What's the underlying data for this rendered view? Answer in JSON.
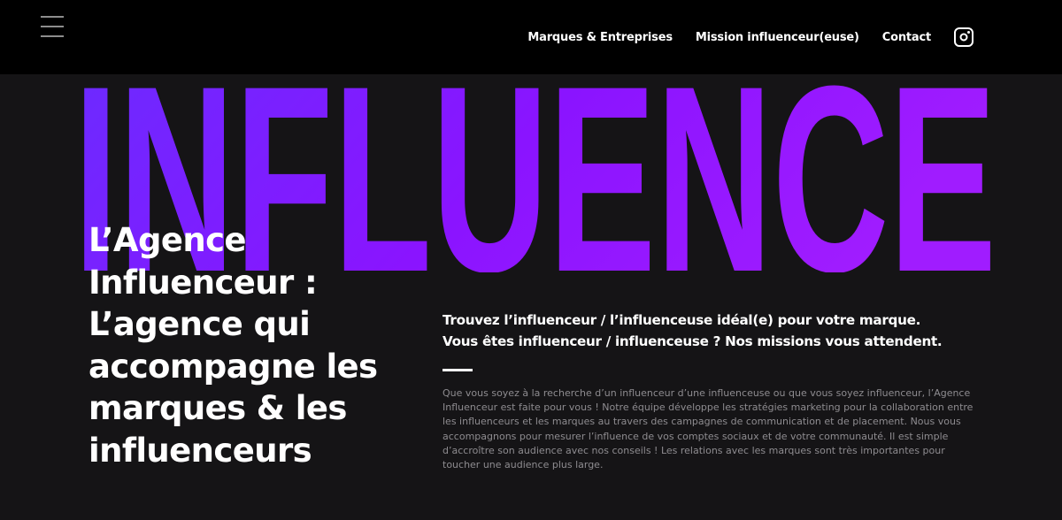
{
  "header": {
    "nav": [
      {
        "label": "Marques & Entreprises"
      },
      {
        "label": "Mission influenceur(euse)"
      },
      {
        "label": "Contact"
      }
    ]
  },
  "hero": {
    "big_word": "INFLUENCE",
    "big_word_colors": [
      "#6a2cff",
      "#8a14ff",
      "#a01cff"
    ],
    "title": "L’Agence Influenceur : L’agence qui accompagne les marques & les influenceurs",
    "tagline_line1": "Trouvez l’influenceur / l’influenceuse idéal(e) pour votre marque.",
    "tagline_line2": "Vous êtes influenceur / influenceuse ? Nos missions vous attendent.",
    "description": "Que vous soyez à la recherche d’un influenceur d’une influenceuse ou que vous soyez influenceur, l’Agence Influenceur est faite pour vous ! Notre équipe développe les stratégies marketing pour la collaboration entre les influenceurs et les marques au travers des campagnes de communication et de placement. Nous vous accompagnons pour mesurer l’influence de vos comptes sociaux et de votre communauté. Il est simple d’accroître son audience avec nos conseils ! Les relations avec les marques sont très importantes pour toucher une audience plus large."
  },
  "icons": {
    "menu": "hamburger-menu-icon",
    "social": "instagram-icon"
  }
}
